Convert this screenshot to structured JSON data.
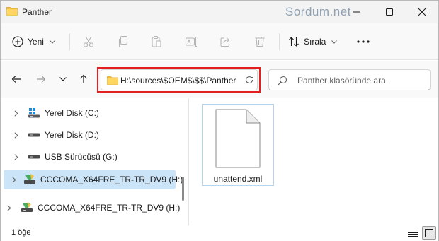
{
  "window": {
    "title": "Panther",
    "watermark": "Sordum.net",
    "title_icon": "folder-icon",
    "controls": [
      "minimize-icon",
      "maximize-icon",
      "close-icon"
    ]
  },
  "commandbar": {
    "new_label": "Yeni",
    "sort_label": "Sırala",
    "icons": [
      "plus-circle-icon",
      "cut-icon",
      "copy-icon",
      "paste-icon",
      "rename-icon",
      "share-icon",
      "delete-icon",
      "sort-icon",
      "more-icon"
    ]
  },
  "address": {
    "path": "H:\\sources\\$OEM$\\$$\\Panther",
    "search_placeholder": "Panther klasöründe ara"
  },
  "navpane": {
    "items": [
      {
        "label": "Yerel Disk (C:)",
        "icon": "windows-drive-icon"
      },
      {
        "label": "Yerel Disk (D:)",
        "icon": "drive-icon"
      },
      {
        "label": "USB Sürücüsü (G:)",
        "icon": "usb-drive-icon"
      },
      {
        "label": "CCCOMA_X64FRE_TR-TR_DV9 (H:)",
        "icon": "dvd-drive-icon",
        "selected": true
      },
      {
        "label": "CCCOMA_X64FRE_TR-TR_DV9 (H:)",
        "icon": "dvd-drive-icon"
      }
    ]
  },
  "files": [
    {
      "name": "unattend.xml",
      "icon": "file-icon"
    }
  ],
  "status": {
    "count": "1 öğe"
  },
  "colors": {
    "selection": "#cce4f7",
    "highlight_border": "#e32020",
    "folder_yellow": "#f5c040",
    "watermark": "#8fa0b3"
  }
}
